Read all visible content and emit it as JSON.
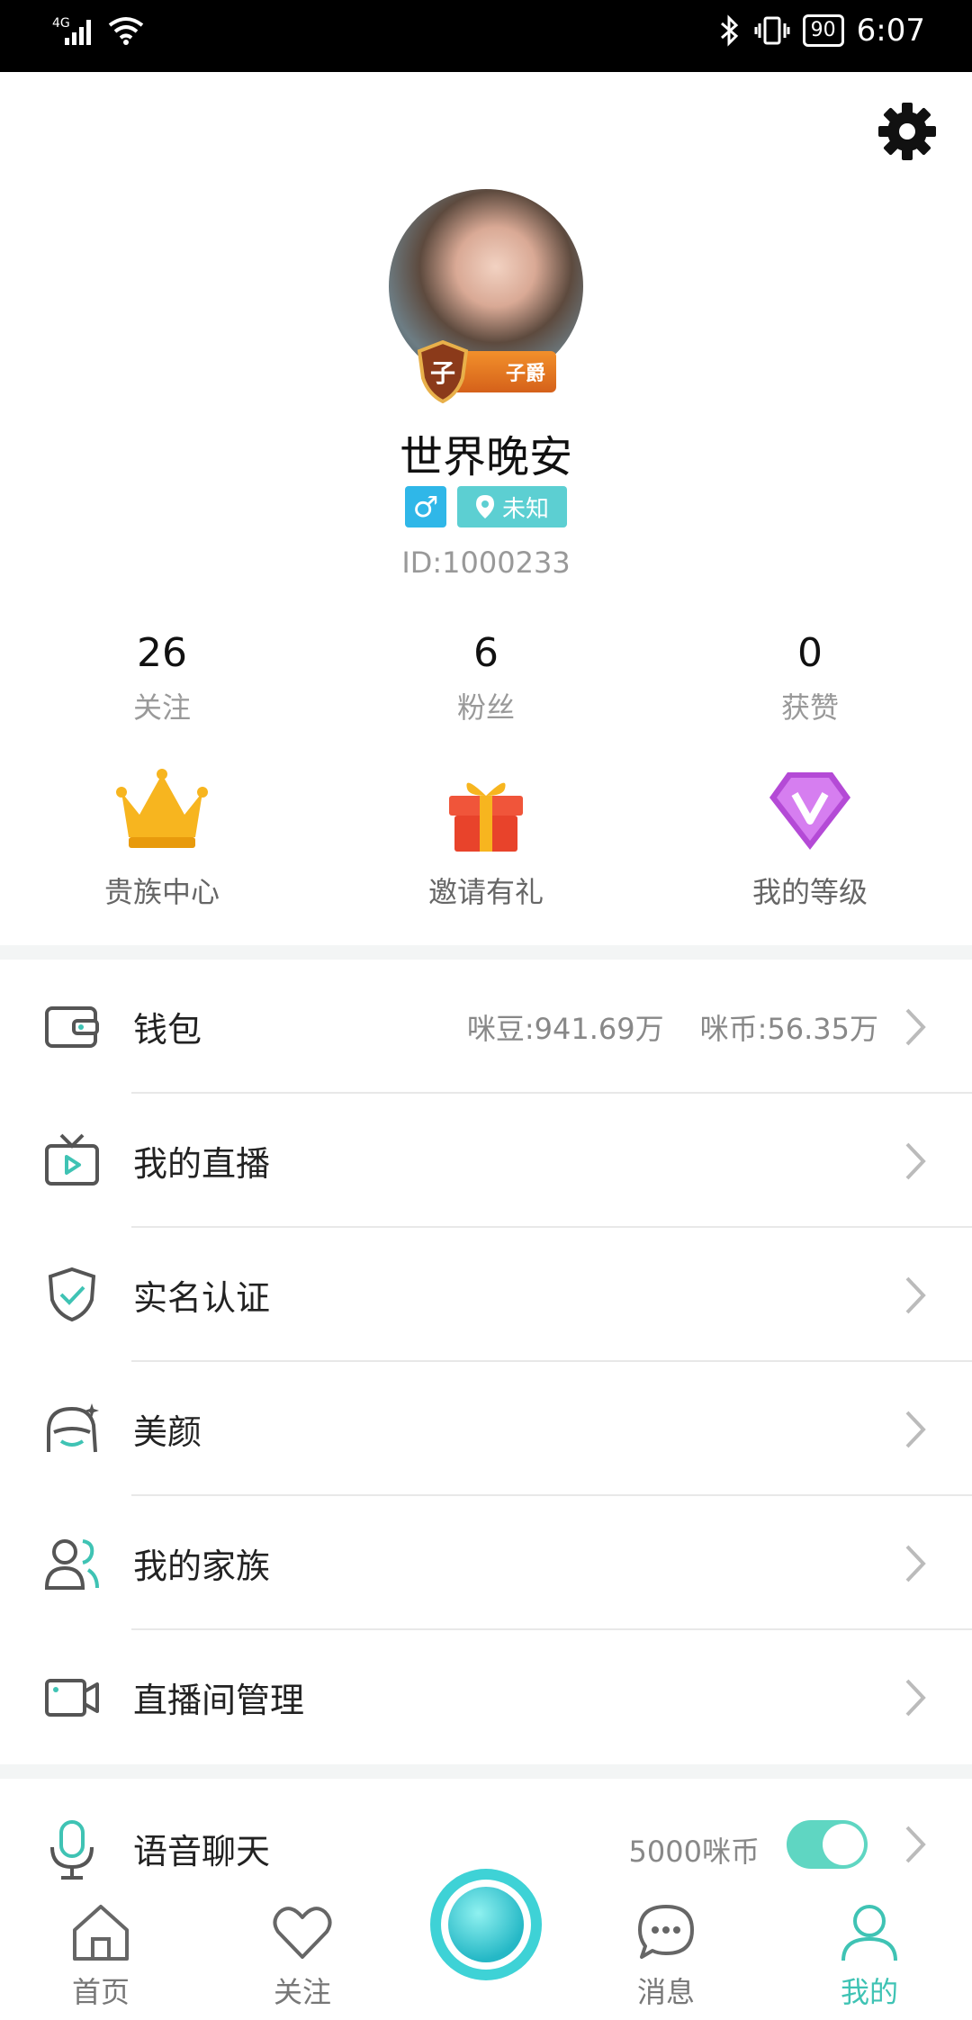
{
  "status_bar": {
    "network": "4G",
    "battery": "90",
    "time": "6:07"
  },
  "profile": {
    "username": "世界晚安",
    "rank_badge": "子爵",
    "rank_badge_char": "子",
    "gender_symbol": "♂",
    "location": "未知",
    "user_id": "ID:1000233"
  },
  "stats": [
    {
      "value": "26",
      "label": "关注"
    },
    {
      "value": "6",
      "label": "粉丝"
    },
    {
      "value": "0",
      "label": "获赞"
    }
  ],
  "features": [
    {
      "label": "贵族中心",
      "icon": "crown-icon"
    },
    {
      "label": "邀请有礼",
      "icon": "gift-icon"
    },
    {
      "label": "我的等级",
      "icon": "diamond-v-icon"
    }
  ],
  "menu": {
    "wallet": {
      "label": "钱包",
      "beans": "咪豆:941.69万",
      "coins": "咪币:56.35万"
    },
    "my_live": {
      "label": "我的直播"
    },
    "real_name": {
      "label": "实名认证"
    },
    "beauty": {
      "label": "美颜"
    },
    "family": {
      "label": "我的家族"
    },
    "room_manage": {
      "label": "直播间管理"
    }
  },
  "voice_chat": {
    "label": "语音聊天",
    "price": "5000咪币",
    "enabled": true
  },
  "tabs": [
    {
      "label": "首页",
      "icon": "home-icon"
    },
    {
      "label": "关注",
      "icon": "heart-icon"
    },
    {
      "label": "消息",
      "icon": "message-icon"
    },
    {
      "label": "我的",
      "icon": "user-icon",
      "active": true
    }
  ],
  "colors": {
    "accent": "#3fc3b4",
    "gender_tag": "#2fb7e8",
    "location_tag": "#5ccfd2",
    "center_button": "#3ed2d6"
  }
}
